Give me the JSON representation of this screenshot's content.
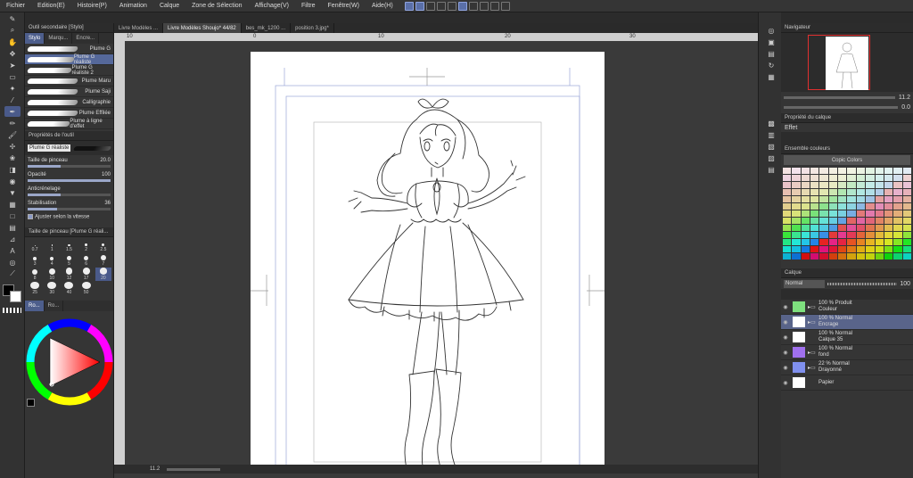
{
  "menu": [
    "Fichier",
    "Edition(E)",
    "Histoire(P)",
    "Animation",
    "Calque",
    "Zone de Sélection",
    "Affichage(V)",
    "Filtre",
    "Fenêtre(W)",
    "Aide(H)"
  ],
  "subtool": {
    "header": "Outil secondaire [Stylo]",
    "tabs": [
      "Stylo",
      "Marqu...",
      "Encre..."
    ],
    "brushes": [
      "Plume G",
      "Plume G réaliste",
      "Plume G réaliste 2",
      "Plume Maru",
      "Plume Saji",
      "Calligraphie",
      "Plume Effilée",
      "Plume à ligne d'effet"
    ],
    "selected_brush_index": 1
  },
  "tool_props": {
    "header": "Propriétés de l'outil",
    "brush_name": "Plume G réaliste",
    "items": [
      {
        "label": "Taille de pinceau",
        "value": "20.0"
      },
      {
        "label": "Opacité",
        "value": "100"
      },
      {
        "label": "Anticrénelage",
        "value": ""
      },
      {
        "label": "Stabilisation",
        "value": "36"
      }
    ],
    "checkbox_label": "Ajuster selon la vitesse"
  },
  "brush_size": {
    "header": "Taille de pinceau [Plume G réali...",
    "sizes": [
      "0.7",
      "1",
      "1.5",
      "2",
      "2.5",
      "3",
      "4",
      "5",
      "6",
      "7",
      "8",
      "10",
      "12",
      "17",
      "20",
      "25",
      "30",
      "40",
      "50"
    ],
    "selected": "20"
  },
  "color_tabs": [
    "Ro...",
    "Ro..."
  ],
  "doc_tabs": [
    "Livre Modèles ...",
    "Livre Modèles Shoujo* 44/82",
    "bes_mk_1200 ...",
    "position 3.jpg*"
  ],
  "ruler_ticks": [
    "10",
    "0",
    "10",
    "20",
    "30"
  ],
  "status": {
    "zoom": "11.2"
  },
  "navigator": {
    "header": "Navigateur",
    "zoom": "11.2",
    "angle": "0.0"
  },
  "layer_props": {
    "header": "Propriété du calque",
    "effect": "Effet"
  },
  "color_set": {
    "header": "Ensemble couleurs",
    "name": "Copic Colors"
  },
  "layers_panel": {
    "header": "Calque",
    "blend": "Normal",
    "opacity": "100",
    "layers": [
      {
        "line1": "100 % Produit",
        "line2": "Couleur",
        "thumb": "#7ee07e",
        "folder": true,
        "sel": false
      },
      {
        "line1": "100 % Normal",
        "line2": "Encrage",
        "thumb": "#ffffff",
        "folder": true,
        "sel": true
      },
      {
        "line1": "100 % Normal",
        "line2": "Calque 35",
        "thumb": "#ffffff",
        "folder": false,
        "sel": false
      },
      {
        "line1": "100 % Normal",
        "line2": "fond",
        "thumb": "#a070ee",
        "folder": true,
        "sel": false
      },
      {
        "line1": "22 % Normal",
        "line2": "Drayonné",
        "thumb": "#8090ee",
        "folder": true,
        "sel": false
      },
      {
        "line1": "",
        "line2": "Papier",
        "thumb": "#ffffff",
        "folder": false,
        "sel": false
      }
    ]
  },
  "colors": {
    "accent": "#4d5e8c",
    "panel": "#353535",
    "paper": "#ffffff"
  }
}
